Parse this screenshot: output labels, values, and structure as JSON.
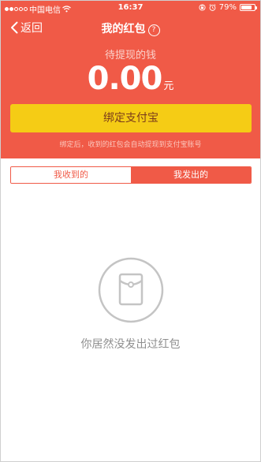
{
  "status_bar": {
    "carrier": "中国电信",
    "time": "16:37",
    "battery_percent_text": "79%",
    "battery_level": 0.79,
    "icons": [
      "signal-dots-icon",
      "wifi-icon",
      "orientation-lock-icon",
      "alarm-icon",
      "battery-icon"
    ]
  },
  "nav": {
    "back_label": "返回",
    "title": "我的红包",
    "help_glyph": "?"
  },
  "wallet": {
    "pending_label": "待提现的钱",
    "amount": "0.00",
    "unit": "元",
    "bind_button_label": "绑定支付宝",
    "hint": "绑定后，收到的红包会自动提现到支付宝账号"
  },
  "tabs": [
    {
      "label": "我收到的",
      "active": false
    },
    {
      "label": "我发出的",
      "active": true
    }
  ],
  "empty_state": {
    "icon": "red-envelope-icon",
    "message": "你居然没发出过红包"
  },
  "colors": {
    "brand_red": "#f05a47",
    "button_yellow": "#f5cc15",
    "empty_gray": "#c4c4c4"
  }
}
